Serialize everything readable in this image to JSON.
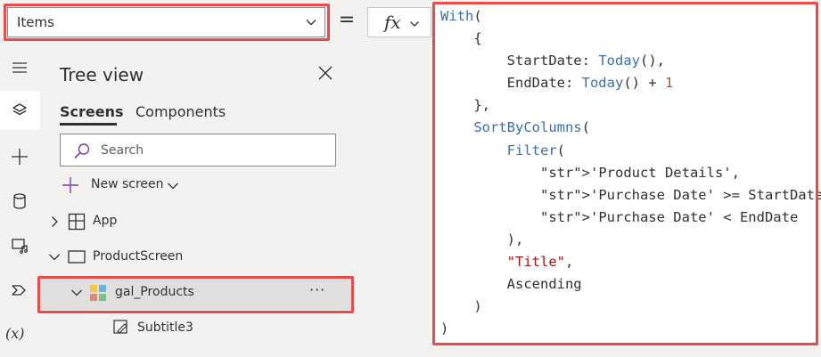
{
  "formula_bar": {
    "property_value": "Items",
    "equals": "=",
    "fx_label": "fx"
  },
  "tree_view": {
    "title": "Tree view",
    "tabs": [
      "Screens",
      "Components"
    ],
    "search_placeholder": "Search",
    "new_screen_label": "New screen",
    "items": [
      {
        "label": "App"
      },
      {
        "label": "ProductScreen"
      },
      {
        "label": "gal_Products",
        "more": "···"
      },
      {
        "label": "Subtitle3"
      }
    ]
  },
  "rail": {
    "variables_label": "(x)"
  },
  "code": {
    "lines": [
      "With(",
      "    {",
      "        StartDate: Today(),",
      "        EndDate: Today() + 1",
      "    },",
      "    SortByColumns(",
      "        Filter(",
      "            'Product Details',",
      "            'Purchase Date' >= StartDate,",
      "            'Purchase Date' < EndDate",
      "        ),",
      "        \"Title\",",
      "        Ascending",
      "    )",
      ")"
    ]
  },
  "colors": {
    "highlight_border": "#e74c4c",
    "function": "#3b6ea8",
    "string": "#0f7b7b",
    "literal": "#a31515",
    "number": "#b5562b"
  }
}
